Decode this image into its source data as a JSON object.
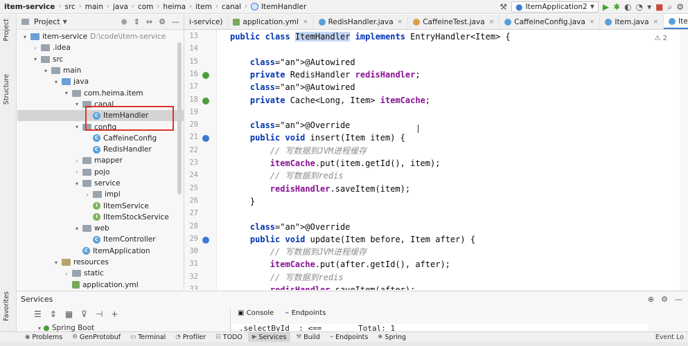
{
  "breadcrumbs": [
    "item-service",
    "src",
    "main",
    "java",
    "com",
    "heima",
    "item",
    "canal",
    "ItemHandler"
  ],
  "run_config": {
    "label": "ItemApplication2"
  },
  "left_strip": {
    "project": "Project",
    "structure": "Structure",
    "favorites": "Favorites"
  },
  "project_panel": {
    "title": "Project",
    "tree": [
      {
        "label": "item-service",
        "extra": "D:\\code\\item-service",
        "depth": 0,
        "chev": "v",
        "icon": "folder-blue"
      },
      {
        "label": ".idea",
        "depth": 1,
        "chev": ">",
        "icon": "folder-gray"
      },
      {
        "label": "src",
        "depth": 1,
        "chev": "v",
        "icon": "folder-gray"
      },
      {
        "label": "main",
        "depth": 2,
        "chev": "v",
        "icon": "folder-gray"
      },
      {
        "label": "java",
        "depth": 3,
        "chev": "v",
        "icon": "folder-blue"
      },
      {
        "label": "com.heima.item",
        "depth": 4,
        "chev": "v",
        "icon": "folder-gray"
      },
      {
        "label": "canal",
        "depth": 5,
        "chev": "v",
        "icon": "folder-gray"
      },
      {
        "label": "ItemHandler",
        "depth": 6,
        "chev": "",
        "icon": "class",
        "selected": true
      },
      {
        "label": "config",
        "depth": 5,
        "chev": "v",
        "icon": "folder-gray"
      },
      {
        "label": "CaffeineConfig",
        "depth": 6,
        "chev": "",
        "icon": "class"
      },
      {
        "label": "RedisHandler",
        "depth": 6,
        "chev": "",
        "icon": "class"
      },
      {
        "label": "mapper",
        "depth": 5,
        "chev": ">",
        "icon": "folder-gray"
      },
      {
        "label": "pojo",
        "depth": 5,
        "chev": ">",
        "icon": "folder-gray"
      },
      {
        "label": "service",
        "depth": 5,
        "chev": "v",
        "icon": "folder-gray"
      },
      {
        "label": "impl",
        "depth": 6,
        "chev": ">",
        "icon": "folder-gray"
      },
      {
        "label": "IItemService",
        "depth": 6,
        "chev": "",
        "icon": "iface"
      },
      {
        "label": "IItemStockService",
        "depth": 6,
        "chev": "",
        "icon": "iface"
      },
      {
        "label": "web",
        "depth": 5,
        "chev": "v",
        "icon": "folder-gray"
      },
      {
        "label": "ItemController",
        "depth": 6,
        "chev": "",
        "icon": "class"
      },
      {
        "label": "ItemApplication",
        "depth": 5,
        "chev": "",
        "icon": "class"
      },
      {
        "label": "resources",
        "depth": 3,
        "chev": "v",
        "icon": "folder-res"
      },
      {
        "label": "static",
        "depth": 4,
        "chev": ">",
        "icon": "folder-gray"
      },
      {
        "label": "application.yml",
        "depth": 4,
        "chev": "",
        "icon": "yml"
      }
    ]
  },
  "tabs": [
    {
      "label": "i-service)",
      "icon": "none"
    },
    {
      "label": "application.yml",
      "icon": "yml"
    },
    {
      "label": "RedisHandler.java",
      "icon": "class"
    },
    {
      "label": "CaffeineTest.java",
      "icon": "test"
    },
    {
      "label": "CaffeineConfig.java",
      "icon": "class"
    },
    {
      "label": "Item.java",
      "icon": "class"
    },
    {
      "label": "ItemHandler.java",
      "icon": "class",
      "active": true
    }
  ],
  "editor": {
    "inspection": "⚠ 2",
    "line_numbers": [
      "13",
      "14",
      "15",
      "16",
      "17",
      "18",
      "19",
      "20",
      "21",
      "22",
      "23",
      "24",
      "25",
      "26",
      "27",
      "28",
      "29",
      "30",
      "31",
      "32",
      "33"
    ],
    "lines": [
      "public class ItemHandler implements EntryHandler<Item> {",
      "",
      "    @Autowired",
      "    private RedisHandler redisHandler;",
      "    @Autowired",
      "    private Cache<Long, Item> itemCache;",
      "",
      "    @Override",
      "    public void insert(Item item) {",
      "        // 写数据到JVM进程缓存",
      "        itemCache.put(item.getId(), item);",
      "        // 写数据到redis",
      "        redisHandler.saveItem(item);",
      "    }",
      "",
      "    @Override",
      "    public void update(Item before, Item after) {",
      "        // 写数据到JVM进程缓存",
      "        itemCache.put(after.getId(), after);",
      "        // 写数据到redis",
      "        redisHandler.saveItem(after);"
    ]
  },
  "services": {
    "title": "Services",
    "tree_item": "Spring Boot",
    "tabs": [
      "Console",
      "Endpoints"
    ],
    "output": ".selectById  : <==        Total: 1"
  },
  "bottom_tabs": [
    "Problems",
    "GenProtobuf",
    "Terminal",
    "Profiler",
    "TODO",
    "Services",
    "Build",
    "Endpoints",
    "Spring"
  ],
  "bottom_active": "Services",
  "bottom_right": "Event Lo"
}
